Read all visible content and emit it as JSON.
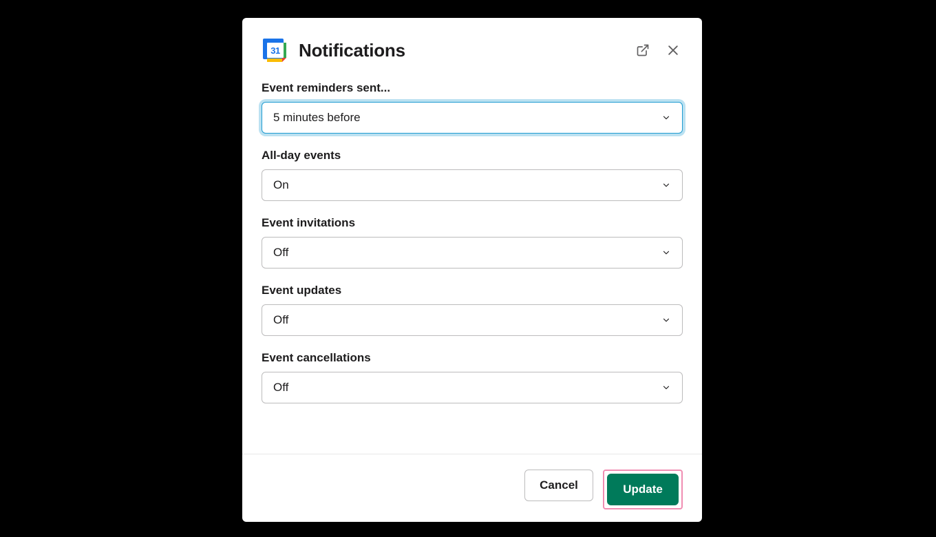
{
  "header": {
    "title": "Notifications",
    "app_icon_day": "31"
  },
  "fields": [
    {
      "label": "Event reminders sent...",
      "value": "5 minutes before",
      "focused": true
    },
    {
      "label": "All-day events",
      "value": "On",
      "focused": false
    },
    {
      "label": "Event invitations",
      "value": "Off",
      "focused": false
    },
    {
      "label": "Event updates",
      "value": "Off",
      "focused": false
    },
    {
      "label": "Event cancellations",
      "value": "Off",
      "focused": false
    }
  ],
  "footer": {
    "cancel_label": "Cancel",
    "update_label": "Update"
  }
}
